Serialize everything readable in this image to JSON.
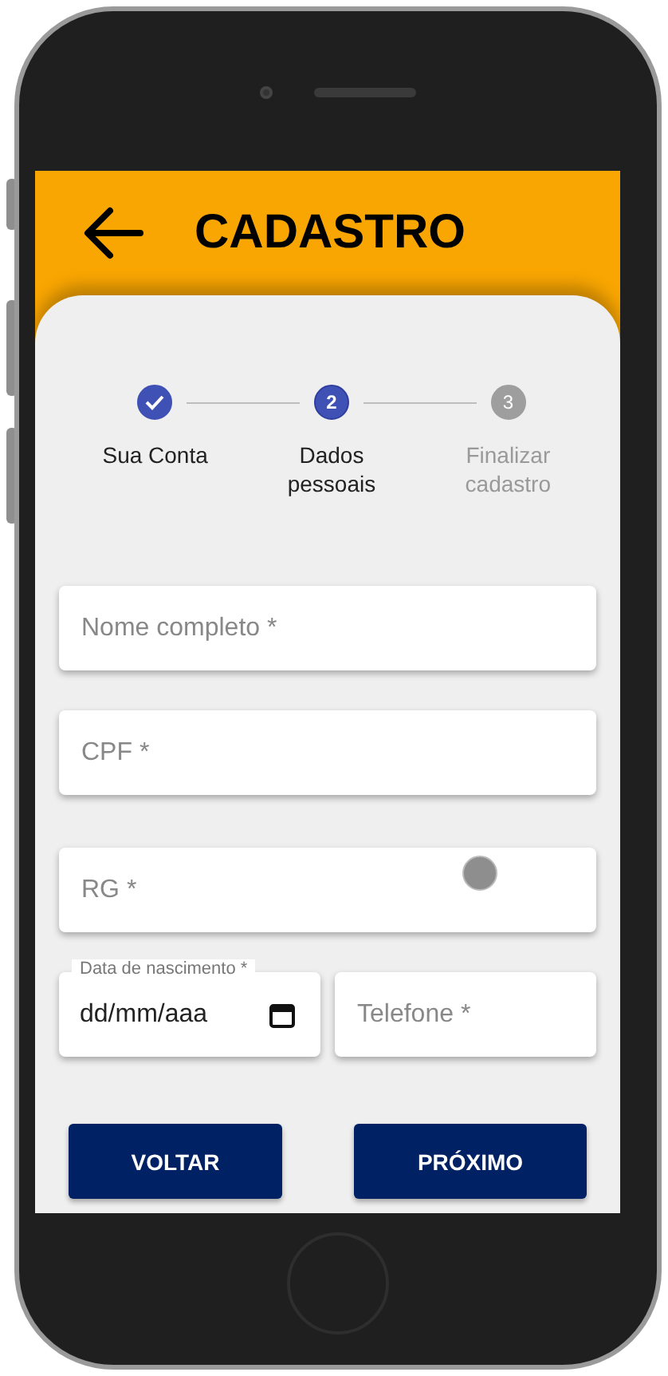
{
  "header": {
    "title": "CADASTRO"
  },
  "steps": [
    {
      "label": "Sua Conta",
      "completed": true,
      "selected": false
    },
    {
      "label": "Dados pessoais",
      "number": "2",
      "completed": false,
      "selected": true
    },
    {
      "label": "Finalizar cadastro",
      "number": "3",
      "completed": false,
      "selected": false
    }
  ],
  "fields": [
    {
      "kind": "text",
      "placeholder": "Nome completo *",
      "touch": false
    },
    {
      "kind": "text",
      "placeholder": "CPF *",
      "touch": false
    },
    {
      "kind": "text",
      "placeholder": "RG *",
      "touch": true
    }
  ],
  "date_field": {
    "label": "Data de nascimento *",
    "value": "dd/mm/aaa"
  },
  "phone_field": {
    "placeholder": "Telefone *"
  },
  "buttons": [
    "VOLTAR",
    "PRÓXIMO"
  ]
}
